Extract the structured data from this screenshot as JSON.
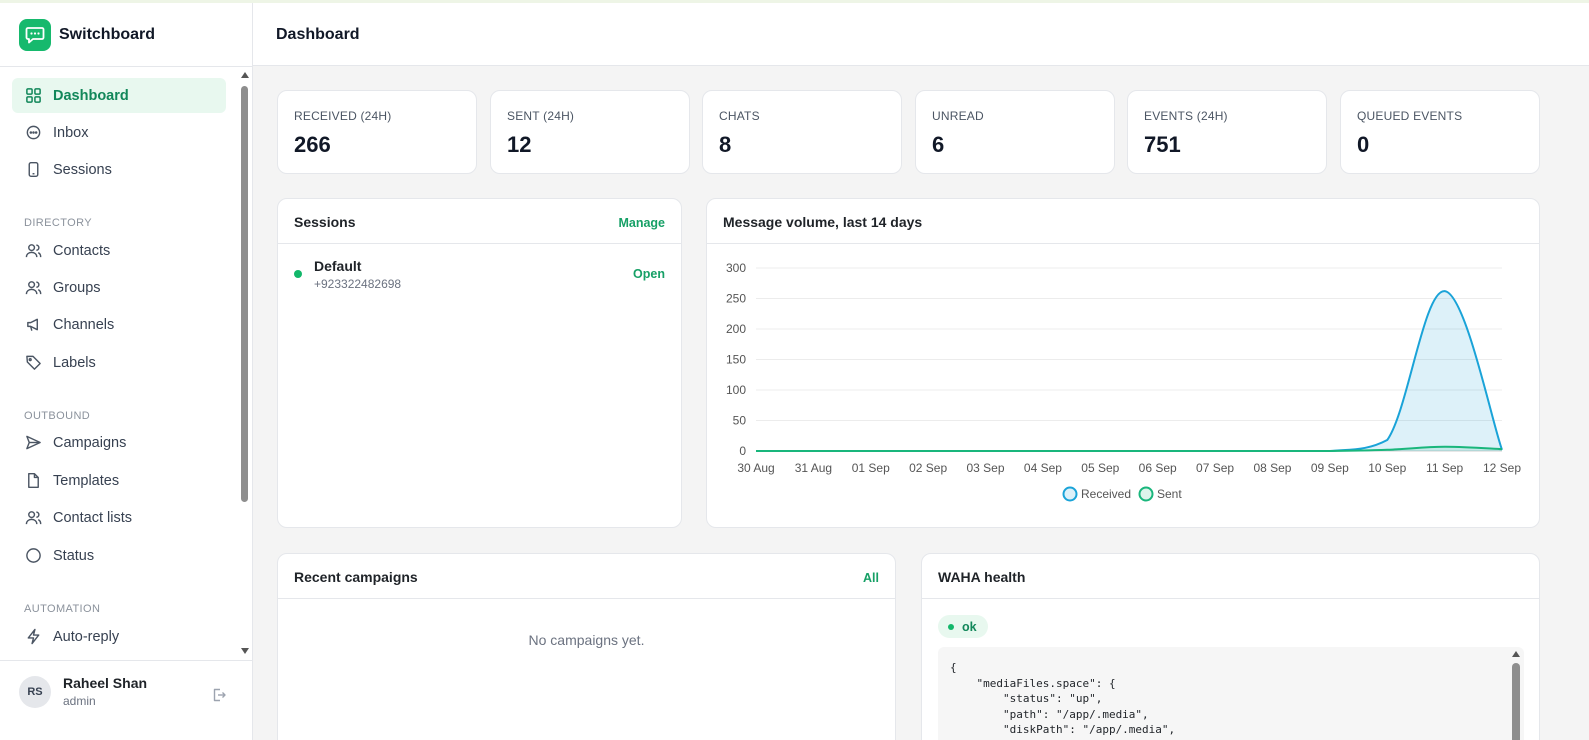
{
  "app": {
    "name": "Switchboard",
    "brand_color": "#16b96d"
  },
  "header": {
    "title": "Dashboard"
  },
  "sidebar": {
    "items": [
      {
        "label": "Dashboard",
        "icon": "grid-icon"
      },
      {
        "label": "Inbox",
        "icon": "chat-bubble-icon"
      },
      {
        "label": "Sessions",
        "icon": "phone-icon"
      },
      {
        "label": "Contacts",
        "icon": "users-icon"
      },
      {
        "label": "Groups",
        "icon": "users-icon"
      },
      {
        "label": "Channels",
        "icon": "megaphone-icon"
      },
      {
        "label": "Labels",
        "icon": "tag-icon"
      },
      {
        "label": "Campaigns",
        "icon": "send-icon"
      },
      {
        "label": "Templates",
        "icon": "file-icon"
      },
      {
        "label": "Contact lists",
        "icon": "users-icon"
      },
      {
        "label": "Status",
        "icon": "circle-icon"
      },
      {
        "label": "Auto-reply",
        "icon": "bolt-icon"
      }
    ],
    "sections": {
      "directory": "DIRECTORY",
      "outbound": "OUTBOUND",
      "automation": "AUTOMATION"
    }
  },
  "user": {
    "initials": "RS",
    "name": "Raheel Shan",
    "role": "admin"
  },
  "stats": [
    {
      "label": "RECEIVED (24H)",
      "value": "266"
    },
    {
      "label": "SENT (24H)",
      "value": "12"
    },
    {
      "label": "CHATS",
      "value": "8"
    },
    {
      "label": "UNREAD",
      "value": "6"
    },
    {
      "label": "EVENTS (24H)",
      "value": "751"
    },
    {
      "label": "QUEUED EVENTS",
      "value": "0"
    }
  ],
  "sessions_card": {
    "title": "Sessions",
    "manage_label": "Manage",
    "session": {
      "name": "Default",
      "phone": "+923322482698",
      "open_label": "Open",
      "status_color": "#12b76a"
    }
  },
  "chart_card": {
    "title": "Message volume, last 14 days"
  },
  "campaigns_card": {
    "title": "Recent campaigns",
    "all_label": "All",
    "empty_text": "No campaigns yet."
  },
  "health_card": {
    "title": "WAHA health",
    "status": "ok",
    "json_text": "{\n    \"mediaFiles.space\": {\n        \"status\": \"up\",\n        \"path\": \"/app/.media\",\n        \"diskPath\": \"/app/.media\","
  },
  "chart_data": {
    "type": "area",
    "categories": [
      "30 Aug",
      "31 Aug",
      "01 Sep",
      "02 Sep",
      "03 Sep",
      "04 Sep",
      "05 Sep",
      "06 Sep",
      "07 Sep",
      "08 Sep",
      "09 Sep",
      "10 Sep",
      "11 Sep",
      "12 Sep"
    ],
    "series": [
      {
        "name": "Received",
        "values": [
          0,
          0,
          0,
          0,
          0,
          0,
          0,
          0,
          0,
          0,
          0,
          18,
          262,
          2
        ],
        "color": "#1aa3d8"
      },
      {
        "name": "Sent",
        "values": [
          0,
          0,
          0,
          0,
          0,
          0,
          0,
          0,
          0,
          0,
          0,
          2,
          7,
          3
        ],
        "color": "#19b67c"
      }
    ],
    "ylim": [
      0,
      300
    ],
    "yticks": [
      0,
      50,
      100,
      150,
      200,
      250,
      300
    ],
    "grid": true,
    "legend": "bottom"
  }
}
